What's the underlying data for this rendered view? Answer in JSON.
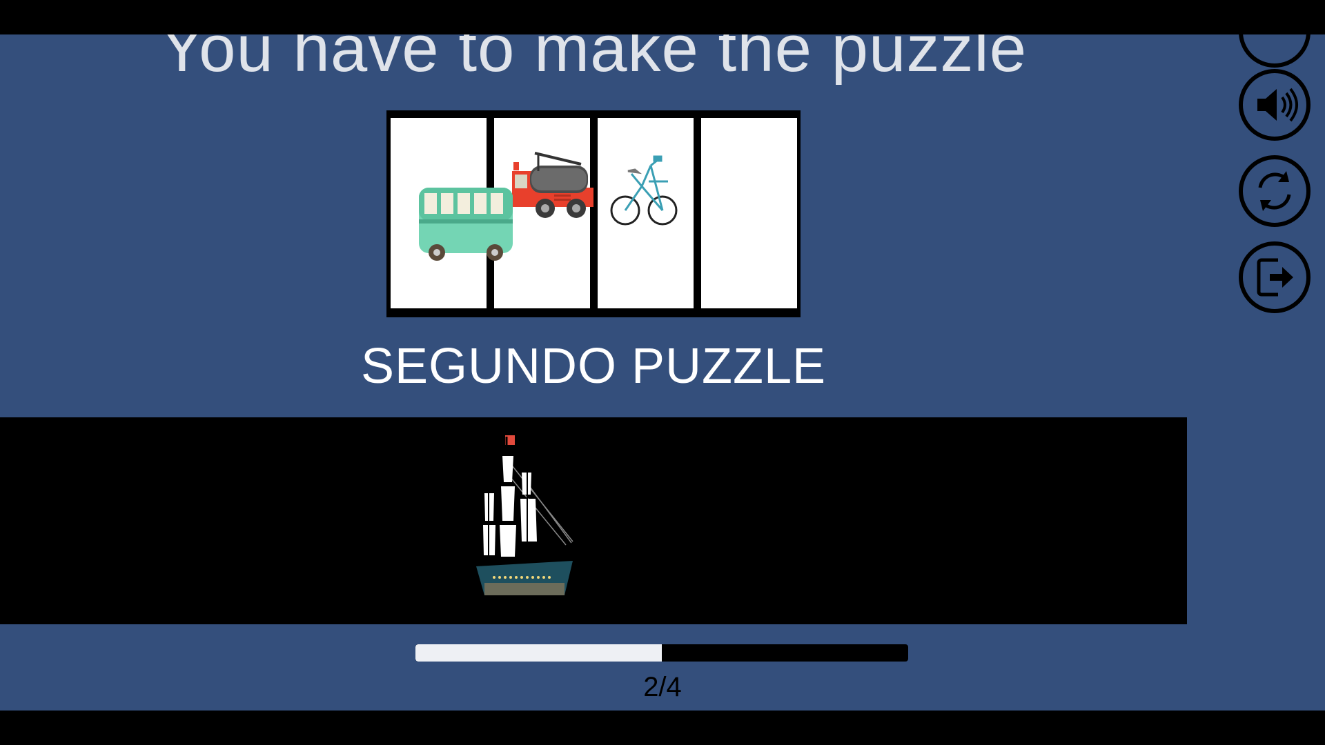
{
  "game": {
    "instruction": "You have to make the puzzle",
    "puzzle_title": "SEGUNDO PUZZLE",
    "progress": {
      "label": "2/4",
      "fraction": 0.5
    },
    "board": {
      "slots": [
        {
          "name": "slot-1",
          "content": "bus-left"
        },
        {
          "name": "slot-2",
          "content": "fire-truck"
        },
        {
          "name": "slot-3",
          "content": "bicycle"
        },
        {
          "name": "slot-4",
          "content": "empty"
        }
      ]
    },
    "tray": {
      "pieces": [
        "sailing-ship"
      ]
    },
    "side_buttons": [
      "hidden-top-icon",
      "speaker-icon",
      "restart-icon",
      "exit-icon"
    ]
  },
  "colors": {
    "background": "#344f7c",
    "letterbox": "#000000",
    "progress_fill": "#eef0f4",
    "title_text": "#ffffff"
  }
}
